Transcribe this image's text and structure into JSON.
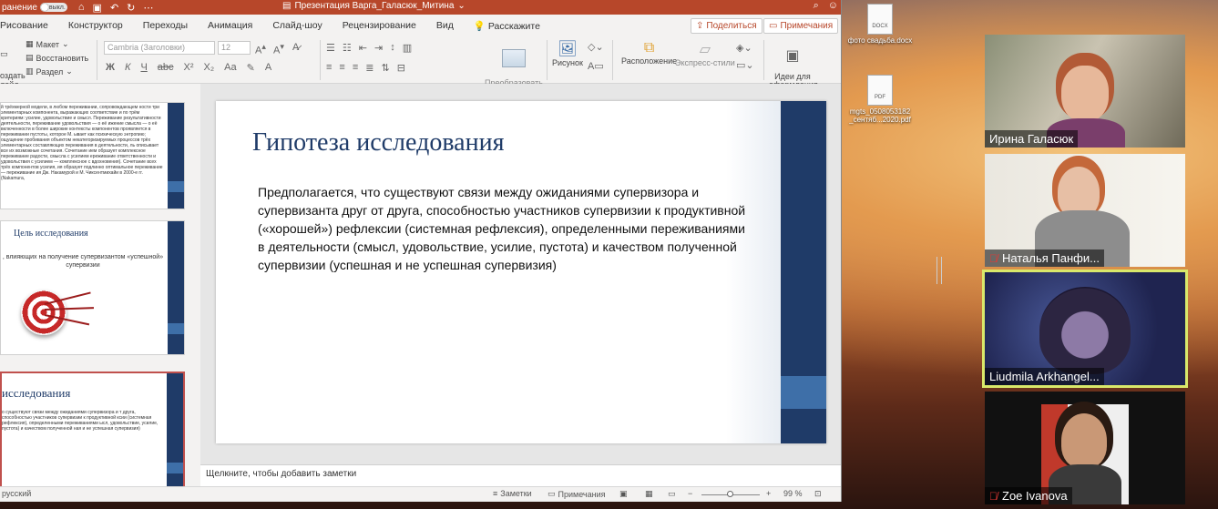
{
  "titlebar": {
    "autosave_label": "ранение",
    "toggle_label": "выкл.",
    "doc_title": "Презентация Варга_Галасюк_Митина",
    "search_icon": "magnifier-icon"
  },
  "tabs": [
    "Рисование",
    "Конструктор",
    "Переходы",
    "Анимация",
    "Слайд-шоу",
    "Рецензирование",
    "Вид",
    "Расскажите"
  ],
  "share_label": "Поделиться",
  "comments_label": "Примечания",
  "ribbon": {
    "create_slide": "оздать\nлайд",
    "layout": "Макет",
    "reset": "Восстановить",
    "section": "Раздел",
    "font_name": "Cambria (Заголовки)",
    "font_size": "12",
    "smartart": "Преобразовать\nв SmartArt",
    "picture": "Рисунок",
    "arrange": "Расположение",
    "quick_styles": "Экспресс-стили",
    "design_ideas": "Идеи для\nоформления"
  },
  "thumbnails": {
    "slide1_text": "й трёхмерной модели, в любом переживании, сопровождающем ности три элементарных компонента, выражающих соответствие и по трём критериям: усилие, удовольствие и смысл. Переживание результативности деятельности, переживание удовольствия — о её ижение смысла — о её включенности в более широкие контексты компонентов проявляется в переживании пустоты, которое М. ывает как психическую энтропию; ощущение пробивания объектом некатегоризируемых процессов трёх элементарных составляющих переживания в деятельности, ль описывает все их возможные сочетания. Сочетание ием образует комплексное переживание радости, смысла с усилием ереживание ответственности и удовольствия с усилием — комплексное с вдохновения). Сочетание всех трёх компонентов усилия, ия образует подлинно оптимальное переживание — переживание ия Дж. Накамурой и М. Чиксентмихайи в 2000-е гг. (Nakamura,",
    "slide2_title": "Цель исследования",
    "slide2_text": ", влияющих на получение супервизантом «успешной» супервизии",
    "slide3_title": "исследования",
    "slide3_text": "о существуют связи между ожиданиями супервизора и т друга, способностью участников супервизии к продуктивной ксии (системная рефлексия), определенными переживаниями ысл, удовольствие, усилие, пустота) и качеством полученной ная и не успешная супервизия)"
  },
  "slide": {
    "title": "Гипотеза исследования",
    "body": "Предполагается, что существуют связи между ожиданиями супервизора и супервизанта друг от друга, способностью участников супервизии к продуктивной («хорошей») рефлексии (системная рефлексия), определенными переживаниями в деятельности (смысл, удовольствие, усилие, пустота) и качеством полученной супервизии (успешная и не успешная супервизия)"
  },
  "notes_placeholder": "Щелкните, чтобы добавить заметки",
  "statusbar": {
    "language": "русский",
    "notes": "Заметки",
    "comments": "Примечания",
    "zoom": "99 %"
  },
  "desktop_files": [
    {
      "name": "фото свадьба.docx",
      "ext": "DOCX"
    },
    {
      "name": "mgts_0508053182 _сентяб...2020.pdf",
      "ext": "PDF"
    }
  ],
  "participants": [
    {
      "name": "Ирина Галасюк",
      "muted": false
    },
    {
      "name": "Наталья Панфи...",
      "muted": true
    },
    {
      "name": "Liudmila Arkhangel...",
      "muted": false
    },
    {
      "name": "Zoe Ivanova",
      "muted": true
    }
  ],
  "colors": {
    "ppt_accent": "#b7472a",
    "slide_navy": "#1f3b68",
    "slide_blue": "#3e6fa8",
    "active_speaker": "#d9e86a",
    "mute_red": "#e53935"
  }
}
